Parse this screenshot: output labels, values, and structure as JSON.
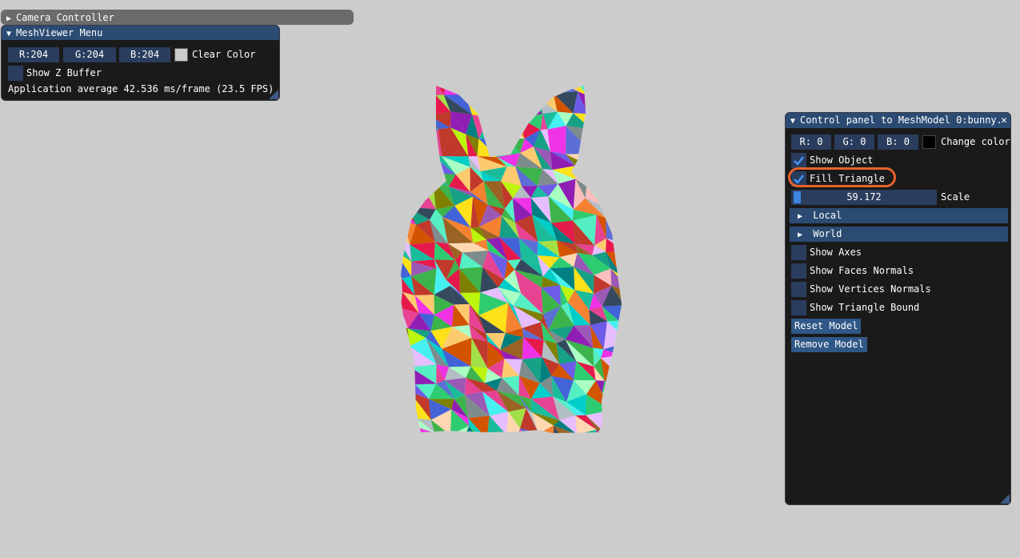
{
  "camera_controller": {
    "title": "Camera Controller"
  },
  "meshviewer": {
    "title": "MeshViewer Menu",
    "r": "R:204",
    "g": "G:204",
    "b": "B:204",
    "clear_color_label": "Clear Color",
    "clear_color": "#cccccc",
    "show_z_buffer_label": "Show Z Buffer",
    "show_z_buffer": false,
    "fps_text": "Application average 42.536 ms/frame (23.5 FPS)"
  },
  "control_panel": {
    "title": "Control panel to MeshModel 0:bunny.",
    "close_glyph": "✕",
    "r": "R:  0",
    "g": "G:  0",
    "b": "B:  0",
    "change_color_label": "Change color",
    "model_color": "#000000",
    "show_object_label": "Show Object",
    "show_object": true,
    "fill_triangle_label": "Fill Triangle",
    "fill_triangle": true,
    "scale_value": "59.172",
    "scale_label": "Scale",
    "local_label": "Local",
    "world_label": "World",
    "show_axes_label": "Show Axes",
    "show_faces_normals_label": "Show Faces Normals",
    "show_vertices_normals_label": "Show Vertices Normals",
    "show_triangle_bound_label": "Show Triangle Bound",
    "reset_model_label": "Reset Model",
    "remove_model_label": "Remove Model"
  },
  "colors": {
    "background": "#cccccc",
    "frame": "#2a3d5e",
    "header": "#2b4b73",
    "button": "#2f5787",
    "check": "#4296fa",
    "highlight": "#e8622c"
  }
}
